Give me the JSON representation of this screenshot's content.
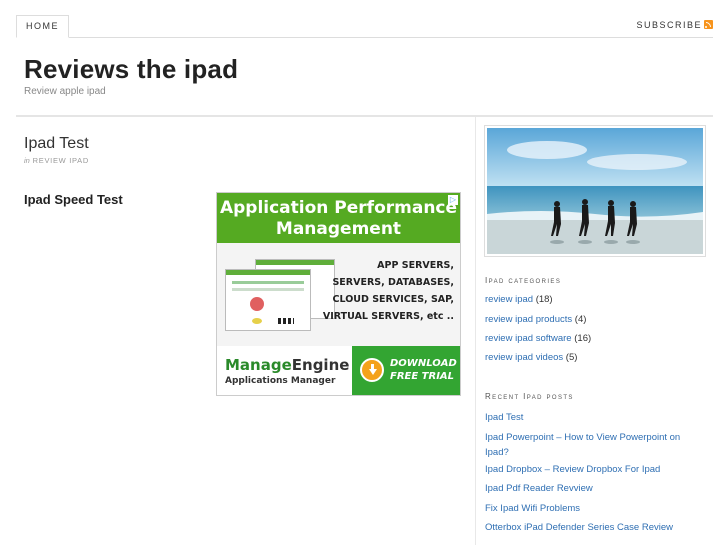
{
  "nav": {
    "home_label": "HOME",
    "subscribe_label": "SUBSCRIBE"
  },
  "site": {
    "title": "Reviews the ipad",
    "description": "Review apple ipad"
  },
  "post": {
    "title": "Ipad Test",
    "meta_prefix": "in",
    "category": "REVIEW IPAD",
    "heading": "Ipad Speed Test"
  },
  "ad": {
    "title_line1": "Application Performance",
    "title_line2": "Management",
    "close_label": "▷",
    "lines": [
      "APP SERVERS,",
      "SERVERS, DATABASES,",
      "CLOUD SERVICES, SAP,",
      "VIRTUAL SERVERS, etc .."
    ],
    "brand_a": "Manage",
    "brand_b": "Engine",
    "product": "Applications Manager",
    "cta_line1": "DOWNLOAD",
    "cta_line2": "FREE TRIAL"
  },
  "sidebar": {
    "categories_title": "Ipad categories",
    "categories": [
      {
        "label": "review ipad",
        "count": "(18)"
      },
      {
        "label": "review ipad products",
        "count": "(4)"
      },
      {
        "label": "review ipad software",
        "count": "(16)"
      },
      {
        "label": "review ipad videos",
        "count": "(5)"
      }
    ],
    "recent_title": "Recent Ipad posts",
    "recent_posts": [
      "Ipad Test",
      "Ipad Powerpoint – How to View Powerpoint on Ipad?",
      "Ipad Dropbox – Review Dropbox For Ipad",
      "Ipad Pdf Reader Revview",
      "Fix Ipad Wifi Problems",
      "Otterbox iPad Defender Series Case Review"
    ]
  },
  "colors": {
    "link": "#2f6fb3",
    "ad_green": "#55aa22",
    "rss_orange": "#f7941d"
  }
}
